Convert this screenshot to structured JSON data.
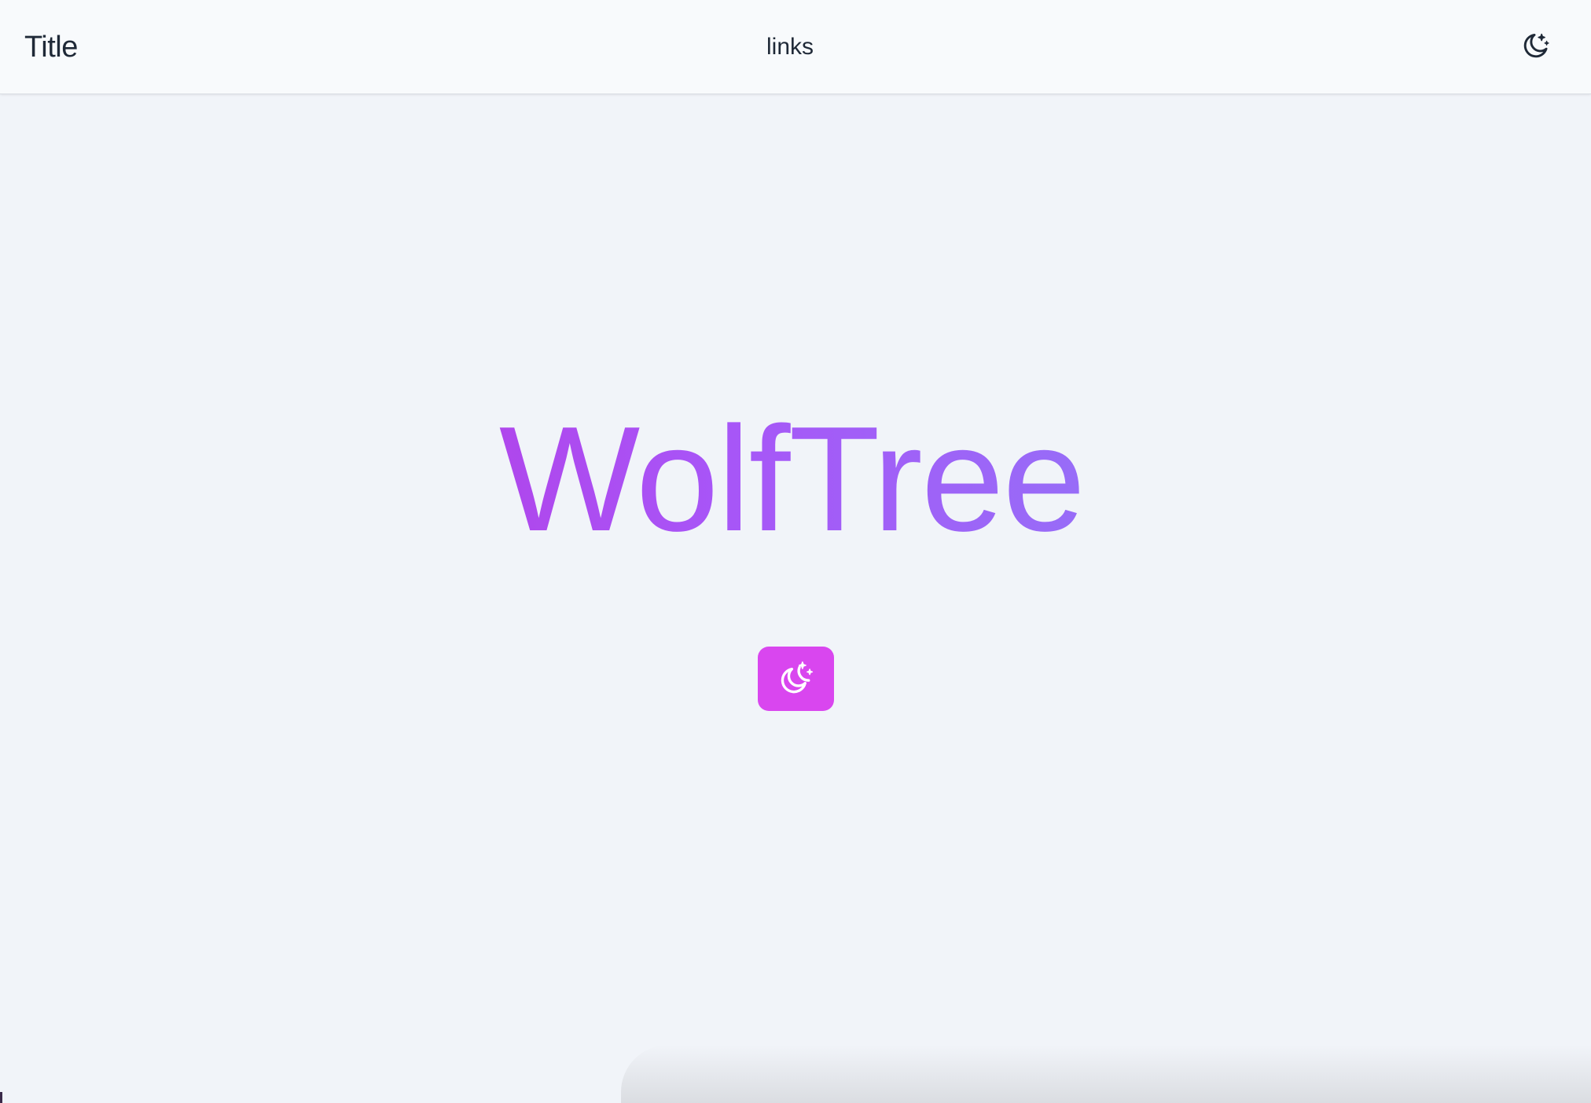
{
  "header": {
    "title": "Title",
    "nav_link": "links",
    "theme_toggle_icon": "moon-stars-icon"
  },
  "hero": {
    "title": "WolfTree",
    "button_icon": "moon-stars-icon"
  },
  "colors": {
    "gradient_start": "#c026d3",
    "gradient_mid": "#a855f7",
    "gradient_end": "#818cf8",
    "button_bg": "#d946ef",
    "text": "#1f2937",
    "page_bg": "#f1f4f9",
    "header_bg": "#f8fafc"
  }
}
